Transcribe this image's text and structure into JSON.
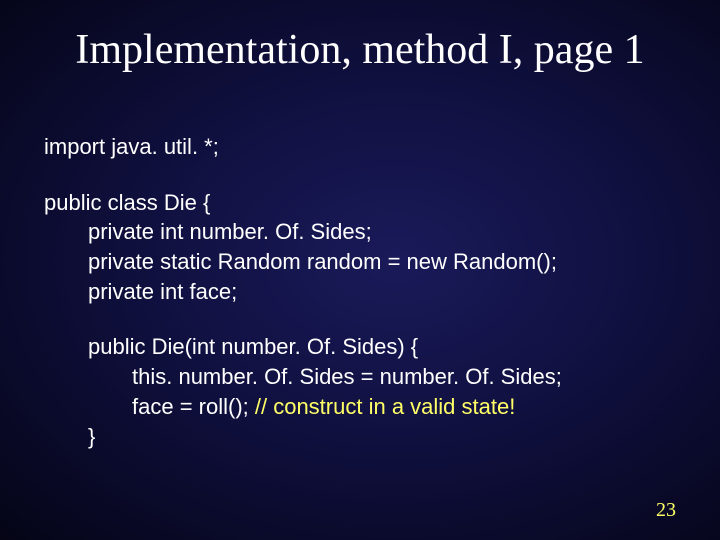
{
  "title": "Implementation, method I, page 1",
  "code": {
    "l1": "import java. util. *;",
    "l2": "public class Die {",
    "l3": "private int number. Of. Sides;",
    "l4": "private static Random random = new Random();",
    "l5": "private int face;",
    "l6": "public Die(int number. Of. Sides) {",
    "l7": "this. number. Of. Sides = number. Of. Sides;",
    "l8a": "face = roll(); ",
    "l8b": "// construct in a valid state!",
    "l9": "}"
  },
  "page_number": "23"
}
